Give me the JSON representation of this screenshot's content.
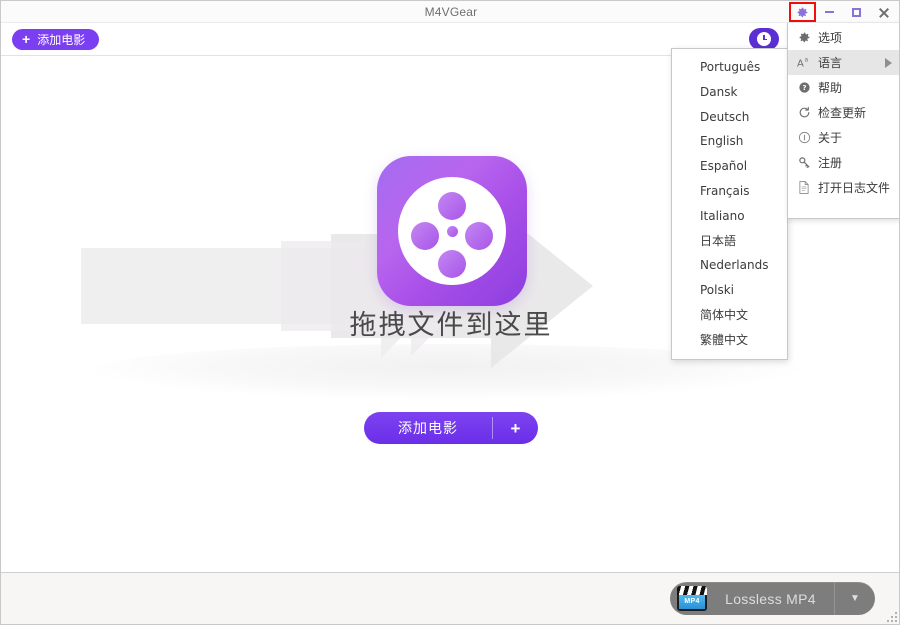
{
  "window": {
    "title": "M4VGear",
    "controls": {
      "settings": "settings-gear",
      "minimize": "minimize",
      "maximize": "maximize",
      "close": "close"
    }
  },
  "toolbar": {
    "add_movie_label": "添加电影",
    "add_movie_plus": "+",
    "history_icon": "clock-icon"
  },
  "main": {
    "drop_text": "拖拽文件到这里",
    "add_movie_label": "添加电影",
    "add_movie_plus": "+",
    "logo_icon": "film-reel-logo"
  },
  "bottom": {
    "format_label": "Lossless MP4",
    "format_icon_text": "MP4",
    "caret": "▼"
  },
  "settings_menu": {
    "items": [
      {
        "label": "选项",
        "icon": "gear-icon",
        "submenu": false,
        "active": false
      },
      {
        "label": "语言",
        "icon": "language-icon",
        "submenu": true,
        "active": true
      },
      {
        "label": "帮助",
        "icon": "help-icon",
        "submenu": false,
        "active": false
      },
      {
        "label": "检查更新",
        "icon": "refresh-icon",
        "submenu": false,
        "active": false
      },
      {
        "label": "关于",
        "icon": "info-icon",
        "submenu": false,
        "active": false
      },
      {
        "label": "注册",
        "icon": "key-icon",
        "submenu": false,
        "active": false
      },
      {
        "label": "打开日志文件",
        "icon": "document-icon",
        "submenu": false,
        "active": false
      }
    ]
  },
  "language_menu": {
    "items": [
      "Português",
      "Dansk",
      "Deutsch",
      "English",
      "Español",
      "Français",
      "Italiano",
      "日本語",
      "Nederlands",
      "Polski",
      "简体中文",
      "繁體中文"
    ]
  },
  "colors": {
    "accent_purple": "#7b3ff2",
    "deep_purple": "#5b2fd4",
    "annotation_red": "#f30d0d",
    "bottom_gray": "#7d7d7d"
  }
}
